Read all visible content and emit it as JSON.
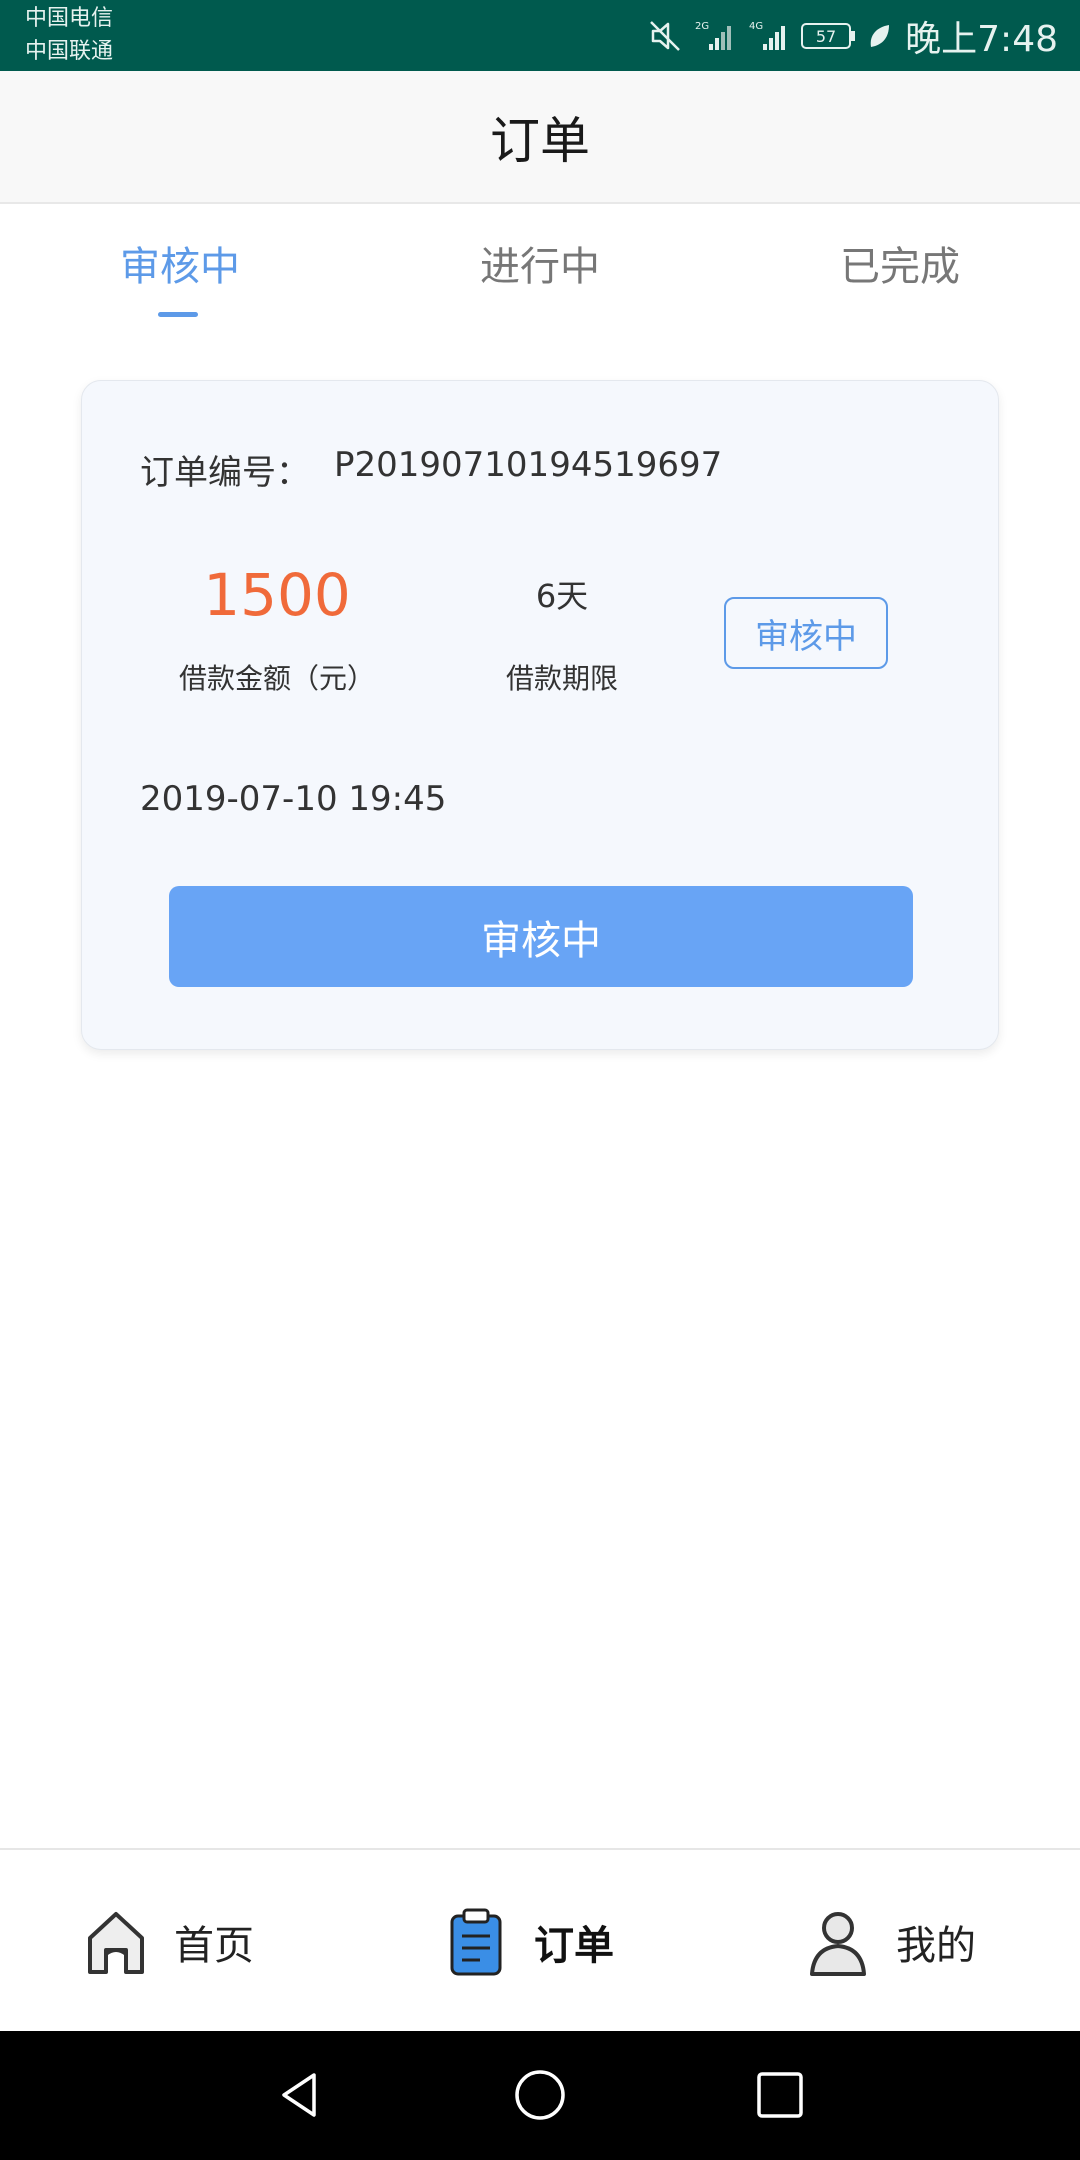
{
  "status_bar": {
    "carrier_1": "中国电信",
    "carrier_2": "中国联通",
    "network_1": "2G",
    "network_2": "4G",
    "battery": "57",
    "time": "晚上7:48"
  },
  "header": {
    "title": "订单"
  },
  "tabs": [
    {
      "label": "审核中",
      "active": true
    },
    {
      "label": "进行中",
      "active": false
    },
    {
      "label": "已完成",
      "active": false
    }
  ],
  "order": {
    "number_label": "订单编号：",
    "number": "P20190710194519697",
    "amount": "1500",
    "amount_label": "借款金额（元）",
    "term": "6天",
    "term_label": "借款期限",
    "status": "审核中",
    "date": "2019-07-10 19:45",
    "button_label": "审核中"
  },
  "bottom_nav": [
    {
      "label": "首页",
      "icon": "home-icon",
      "active": false
    },
    {
      "label": "订单",
      "icon": "orders-icon",
      "active": true
    },
    {
      "label": "我的",
      "icon": "profile-icon",
      "active": false
    }
  ],
  "colors": {
    "status_bar": "#005a4e",
    "accent": "#5d9ae8",
    "button": "#68a4f5",
    "amount": "#f06a3a"
  }
}
